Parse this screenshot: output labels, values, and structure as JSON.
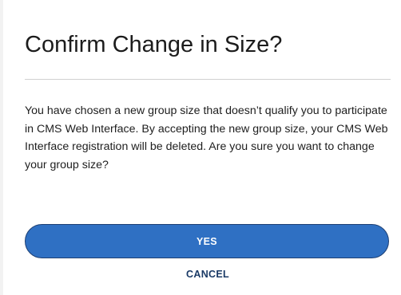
{
  "dialog": {
    "title": "Confirm Change in Size?",
    "message": "You have chosen a new group size that doesn’t qualify you to participate in CMS Web Interface. By accepting the new group size, your CMS Web Interface registration will be deleted. Are you sure you want to change your group size?",
    "yes_label": "YES",
    "cancel_label": "CANCEL"
  },
  "colors": {
    "primary_button": "#2f70c3",
    "primary_button_border": "#1d3f73",
    "cancel_link": "#1a3a66",
    "divider": "#d0d0d0"
  }
}
